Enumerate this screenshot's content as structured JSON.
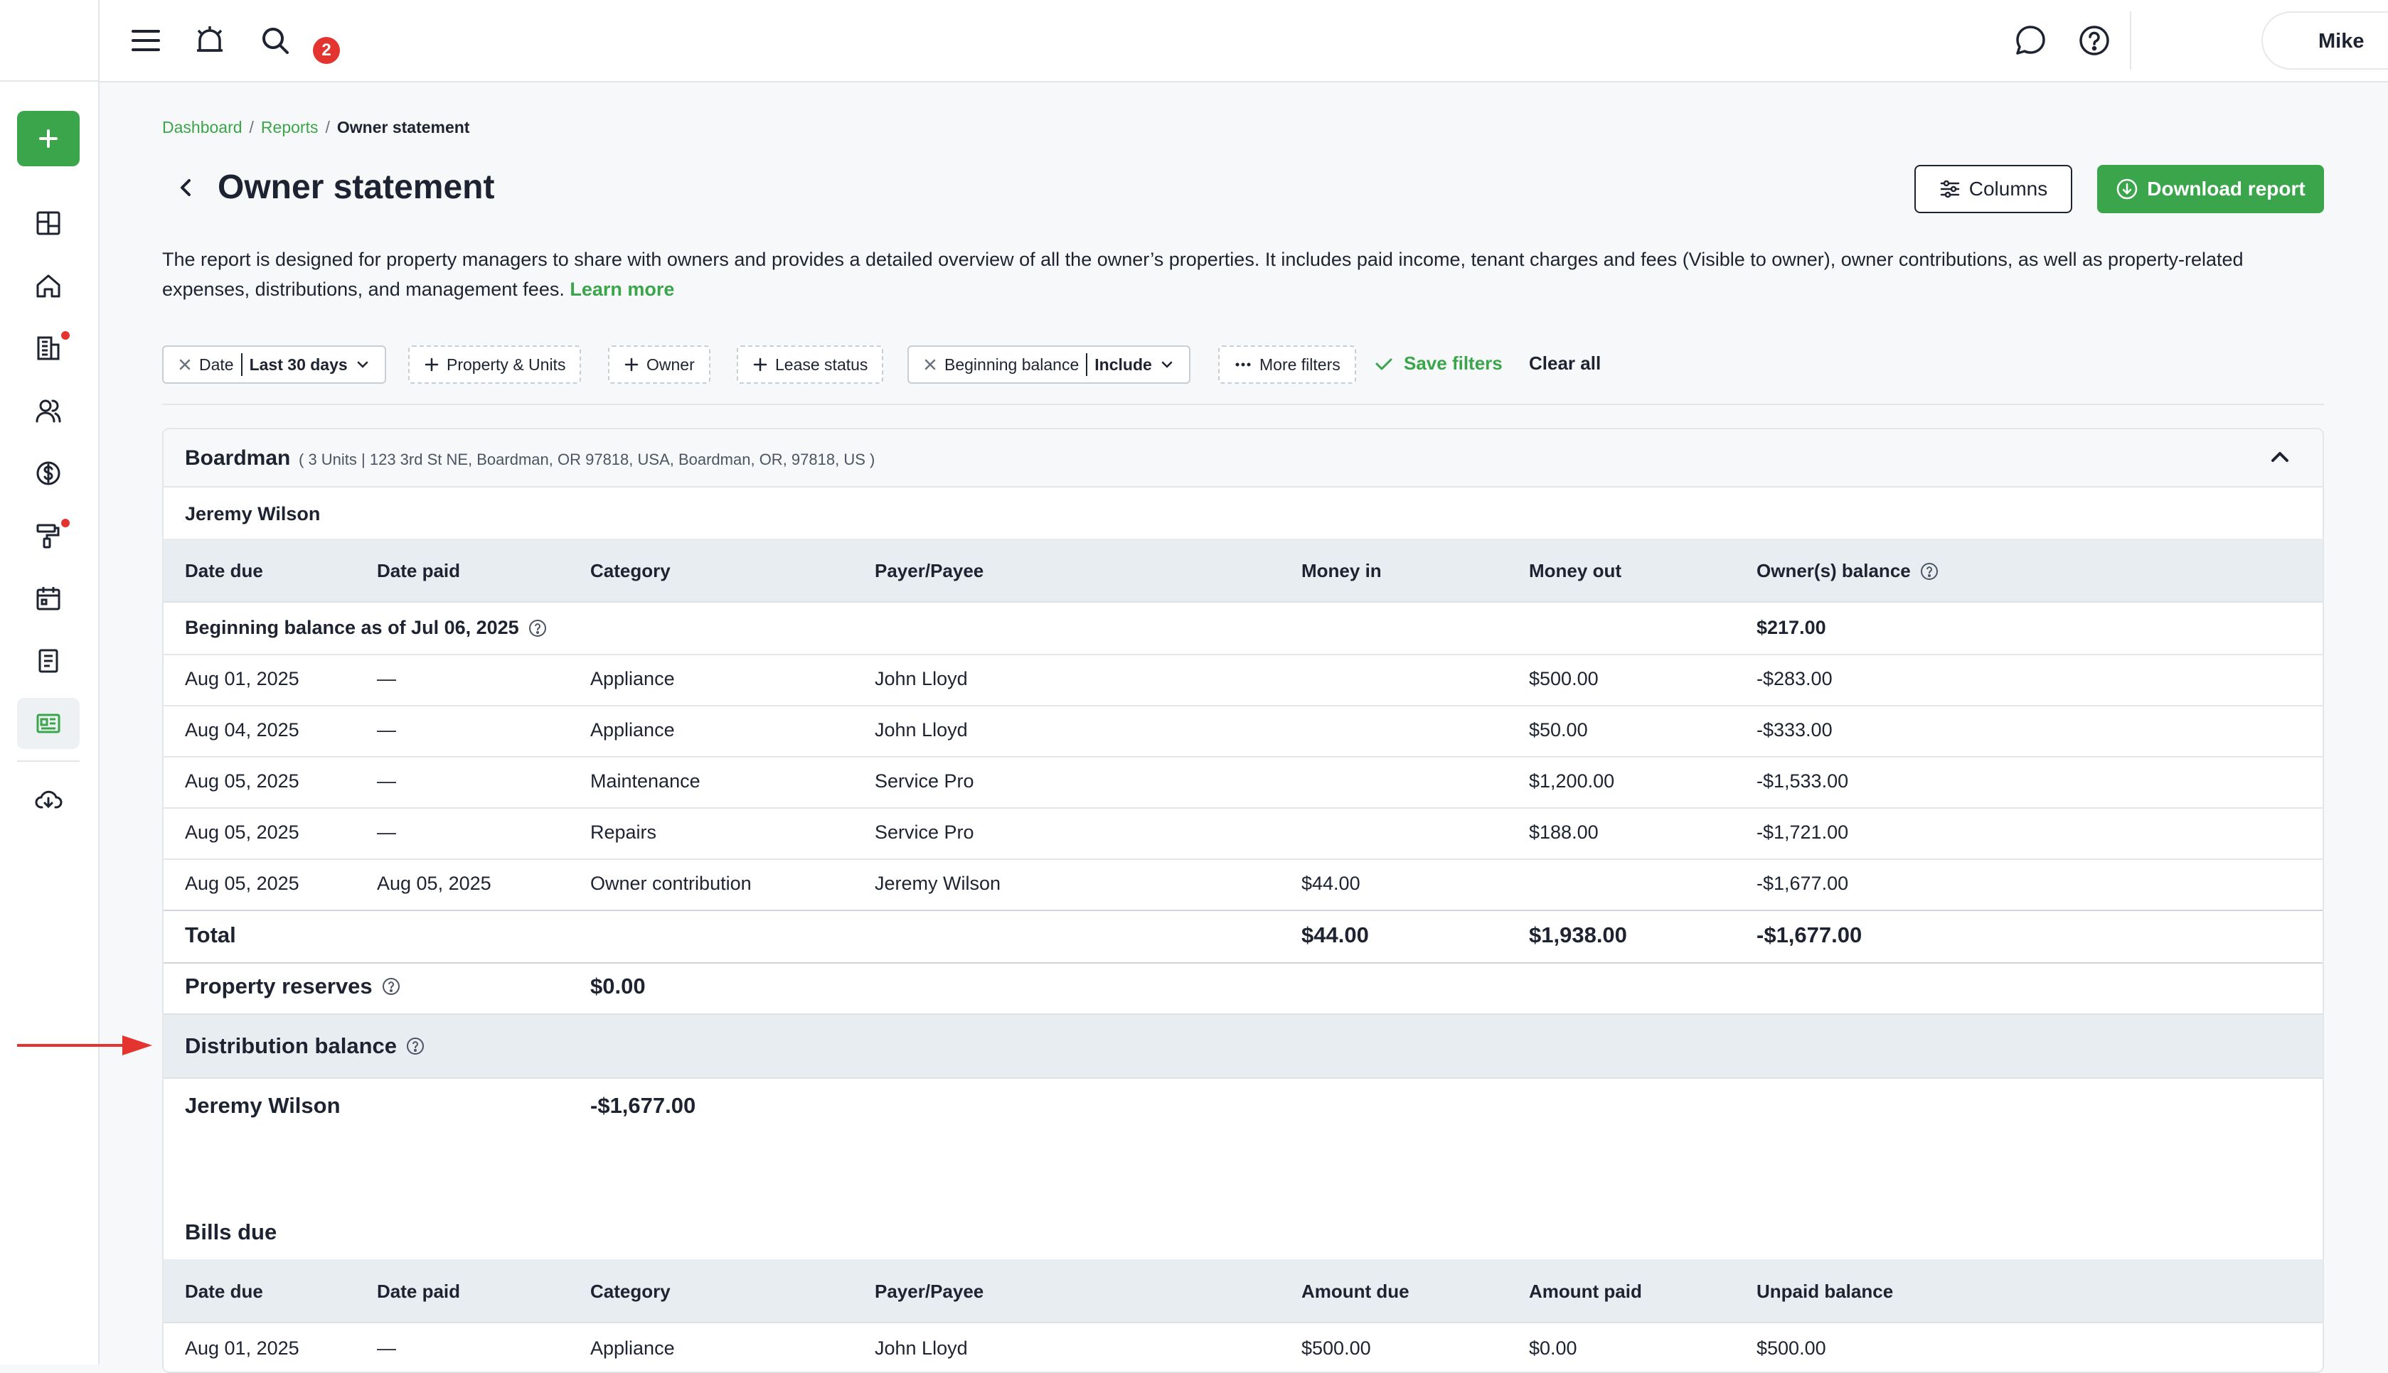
{
  "topbar": {
    "notifications_count": "2",
    "user_name": "Mike"
  },
  "breadcrumb": [
    "Dashboard",
    "Reports",
    "Owner statement"
  ],
  "page": {
    "title": "Owner statement",
    "columns_label": "Columns",
    "download_label": "Download report",
    "description": "The report is designed for property managers to share with owners and provides a detailed overview of all the owner’s properties. It includes paid income, tenant charges and fees (Visible to owner), owner contributions, as well as property-related expenses, distributions, and management fees.",
    "learn_more": "Learn more"
  },
  "filters": {
    "date_label": "Date",
    "date_value": "Last 30 days",
    "property_units": "Property & Units",
    "owner": "Owner",
    "lease_status": "Lease status",
    "beginning_label": "Beginning balance",
    "beginning_value": "Include",
    "more_filters": "More filters",
    "save_filters": "Save filters",
    "clear_all": "Clear all"
  },
  "property": {
    "name": "Boardman",
    "address": "( 3 Units | 123 3rd St NE, Boardman, OR 97818, USA, Boardman, OR, 97818, US )",
    "owner": "Jeremy Wilson",
    "columns": [
      "Date due",
      "Date paid",
      "Category",
      "Payer/Payee",
      "Money in",
      "Money out",
      "Owner(s) balance"
    ],
    "beginning_balance": {
      "label": "Beginning balance as of Jul 06, 2025",
      "value": "$217.00"
    },
    "rows": [
      {
        "date_due": "Aug 01, 2025",
        "date_paid": "—",
        "category": "Appliance",
        "payee": "John Lloyd",
        "money_in": "",
        "money_out": "$500.00",
        "balance": "-$283.00"
      },
      {
        "date_due": "Aug 04, 2025",
        "date_paid": "—",
        "category": "Appliance",
        "payee": "John Lloyd",
        "money_in": "",
        "money_out": "$50.00",
        "balance": "-$333.00"
      },
      {
        "date_due": "Aug 05, 2025",
        "date_paid": "—",
        "category": "Maintenance",
        "payee": "Service Pro",
        "money_in": "",
        "money_out": "$1,200.00",
        "balance": "-$1,533.00"
      },
      {
        "date_due": "Aug 05, 2025",
        "date_paid": "—",
        "category": "Repairs",
        "payee": "Service Pro",
        "money_in": "",
        "money_out": "$188.00",
        "balance": "-$1,721.00"
      },
      {
        "date_due": "Aug 05, 2025",
        "date_paid": "Aug 05, 2025",
        "category": "Owner contribution",
        "payee": "Jeremy Wilson",
        "money_in": "$44.00",
        "money_out": "",
        "balance": "-$1,677.00"
      }
    ],
    "total": {
      "label": "Total",
      "money_in": "$44.00",
      "money_out": "$1,938.00",
      "balance": "-$1,677.00"
    },
    "reserves": {
      "label": "Property reserves",
      "value": "$0.00"
    },
    "distribution": {
      "label": "Distribution balance",
      "owner": "Jeremy Wilson",
      "value": "-$1,677.00"
    },
    "bills": {
      "title": "Bills due",
      "columns": [
        "Date due",
        "Date paid",
        "Category",
        "Payer/Payee",
        "Amount due",
        "Amount paid",
        "Unpaid balance"
      ],
      "rows": [
        {
          "date_due": "Aug 01, 2025",
          "date_paid": "—",
          "category": "Appliance",
          "payee": "John Lloyd",
          "amount_due": "$500.00",
          "amount_paid": "$0.00",
          "unpaid": "$500.00"
        }
      ]
    }
  },
  "colors": {
    "accent": "#3aa54a",
    "alert": "#e3342f",
    "header_bg": "#e8edf2",
    "arrow": "#e3342f"
  },
  "icons": [
    "menu-icon",
    "alarm-icon",
    "search-icon",
    "chat-icon",
    "help-icon",
    "plus-icon",
    "dashboard-icon",
    "home-icon",
    "building-icon",
    "users-icon",
    "dollar-icon",
    "paint-roller-icon",
    "calendar-icon",
    "document-icon",
    "reports-icon",
    "cloud-download-icon",
    "chevron-left-icon",
    "chevron-up-icon",
    "sliders-icon",
    "close-icon",
    "check-icon"
  ]
}
